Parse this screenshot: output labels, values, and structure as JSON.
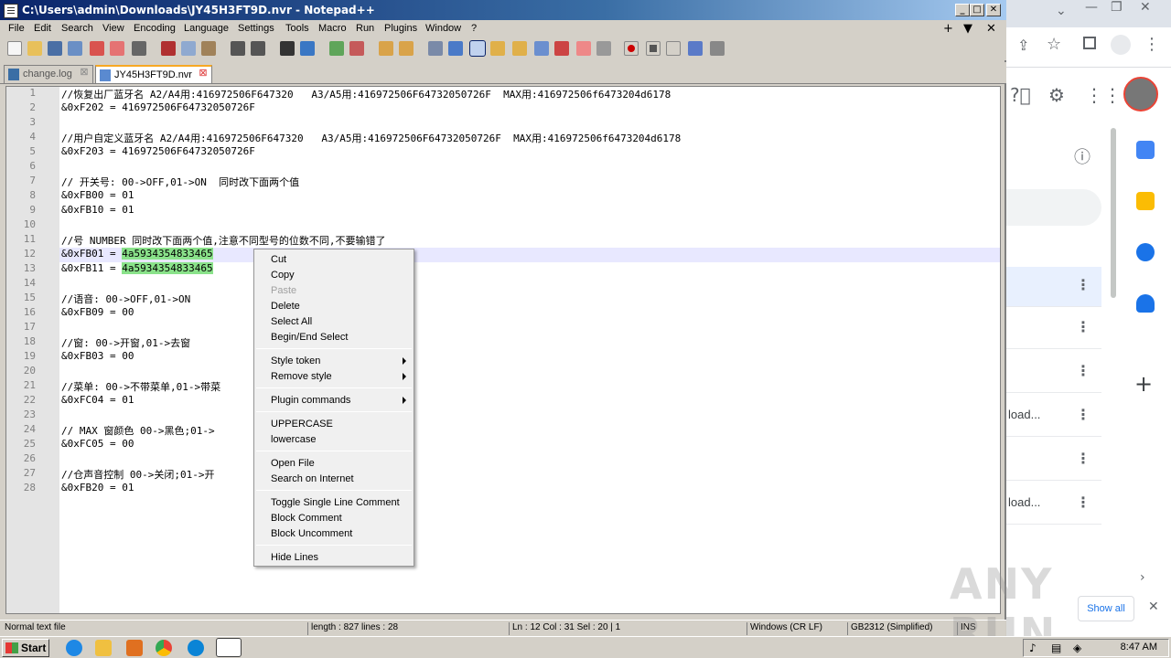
{
  "window": {
    "title": "C:\\Users\\admin\\Downloads\\JY45H3FT9D.nvr - Notepad++",
    "controls": [
      "_",
      "□",
      "✕"
    ]
  },
  "menubar": [
    "File",
    "Edit",
    "Search",
    "View",
    "Encoding",
    "Language",
    "Settings",
    "Tools",
    "Macro",
    "Run",
    "Plugins",
    "Window",
    "?"
  ],
  "menubar_right": [
    "+",
    "▼",
    "✕"
  ],
  "tabs": [
    {
      "label": "change.log",
      "active": false
    },
    {
      "label": "JY45H3FT9D.nvr",
      "active": true
    }
  ],
  "editor": {
    "lines": [
      "//恢复出厂蓝牙名 A2/A4用:416972506F647320   A3/A5用:416972506F64732050726F  MAX用:416972506f6473204d6178",
      "&0xF202 = 416972506F64732050726F",
      "",
      "//用户自定义蓝牙名 A2/A4用:416972506F647320   A3/A5用:416972506F64732050726F  MAX用:416972506f6473204d6178",
      "&0xF203 = 416972506F64732050726F",
      "",
      "// 开关号: 00->OFF,01->ON  同时改下面两个值",
      "&0xFB00 = 01",
      "&0xFB10 = 01",
      "",
      "//号 NUMBER 同时改下面两个值,注意不同型号的位数不同,不要输错了",
      "&0xFB01 = ",
      "&0xFB11 = ",
      "",
      "//语音: 00->OFF,01->ON",
      "&0xFB09 = 00",
      "",
      "//窗: 00->开窗,01->去窗",
      "&0xFB03 = 00",
      "",
      "//菜单: 00->不带菜单,01->带菜",
      "&0xFC04 = 01",
      "",
      "// MAX 窗颜色 00->黑色;01->",
      "&0xFC05 = 00",
      "",
      "//仓声音控制 00->关闭;01->开",
      "&0xFB20 = 01"
    ],
    "selected_text_12": "4a5934354833465",
    "selected_text_13": "4a5934354833465"
  },
  "context_menu": {
    "items": [
      {
        "label": "Cut",
        "enabled": true
      },
      {
        "label": "Copy",
        "enabled": true
      },
      {
        "label": "Paste",
        "enabled": false
      },
      {
        "label": "Delete",
        "enabled": true
      },
      {
        "label": "Select All",
        "enabled": true
      },
      {
        "label": "Begin/End Select",
        "enabled": true
      },
      {
        "label": "Style token",
        "enabled": true,
        "submenu": true
      },
      {
        "label": "Remove style",
        "enabled": true,
        "submenu": true
      },
      {
        "label": "Plugin commands",
        "enabled": true,
        "submenu": true
      },
      {
        "label": "UPPERCASE",
        "enabled": true
      },
      {
        "label": "lowercase",
        "enabled": true
      },
      {
        "label": "Open File",
        "enabled": true
      },
      {
        "label": "Search on Internet",
        "enabled": true
      },
      {
        "label": "Toggle Single Line Comment",
        "enabled": true
      },
      {
        "label": "Block Comment",
        "enabled": true
      },
      {
        "label": "Block Uncomment",
        "enabled": true
      },
      {
        "label": "Hide Lines",
        "enabled": true
      }
    ]
  },
  "statusbar": {
    "type": "Normal text file",
    "length": "length : 827    lines : 28",
    "position": "Ln : 12    Col : 31    Sel : 20 | 1",
    "eol": "Windows (CR LF)",
    "encoding": "GB2312 (Simplified)",
    "mode": "INS"
  },
  "browser": {
    "rows": [
      "",
      "",
      "",
      "load...",
      "",
      "load...",
      ""
    ],
    "show_all": "Show all",
    "watermark": "ANY RUN"
  },
  "taskbar": {
    "start": "Start",
    "clock": "8:47 AM"
  }
}
